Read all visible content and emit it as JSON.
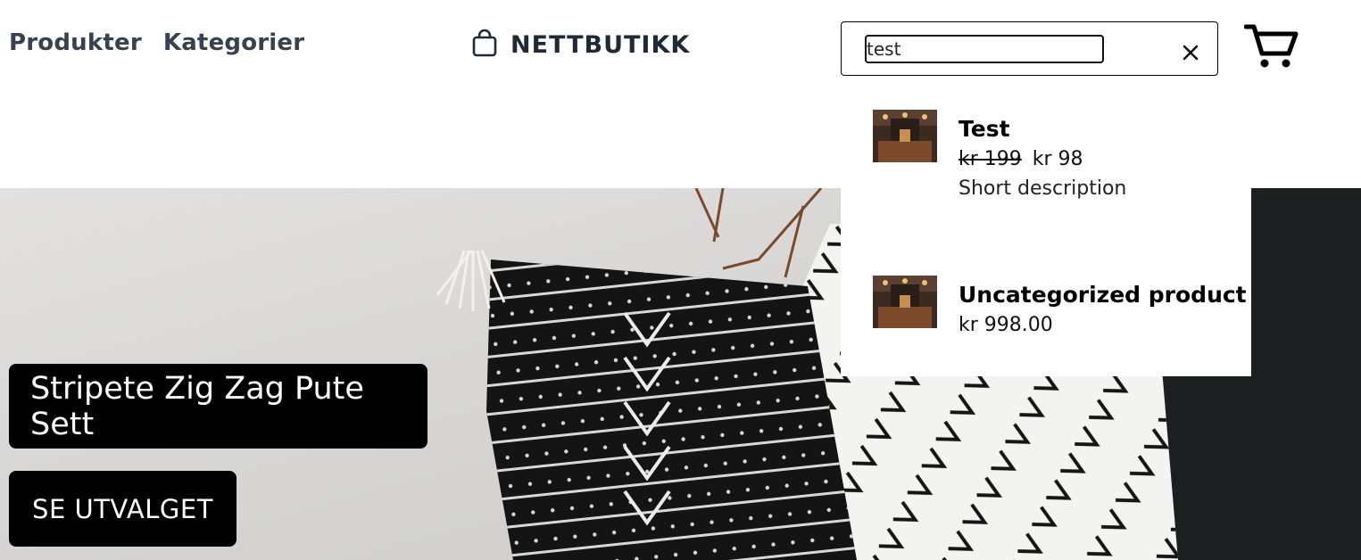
{
  "nav": {
    "products": "Produkter",
    "categories": "Kategorier"
  },
  "brand": {
    "name": "NETTBUTIKK",
    "icon": "shopping-bag-icon"
  },
  "search": {
    "value": "test",
    "clear_icon": "close-icon"
  },
  "cart": {
    "icon": "cart-icon"
  },
  "results": [
    {
      "name": "Test",
      "old_price": "kr 199",
      "price": "kr 98",
      "description": "Short description"
    },
    {
      "name": "Uncategorized product",
      "price": "kr 998.00"
    }
  ],
  "hero": {
    "title": "Stripete Zig Zag Pute Sett",
    "cta": "SE UTVALGET"
  },
  "colors": {
    "text_dark": "#374151",
    "button_bg": "#000000"
  }
}
